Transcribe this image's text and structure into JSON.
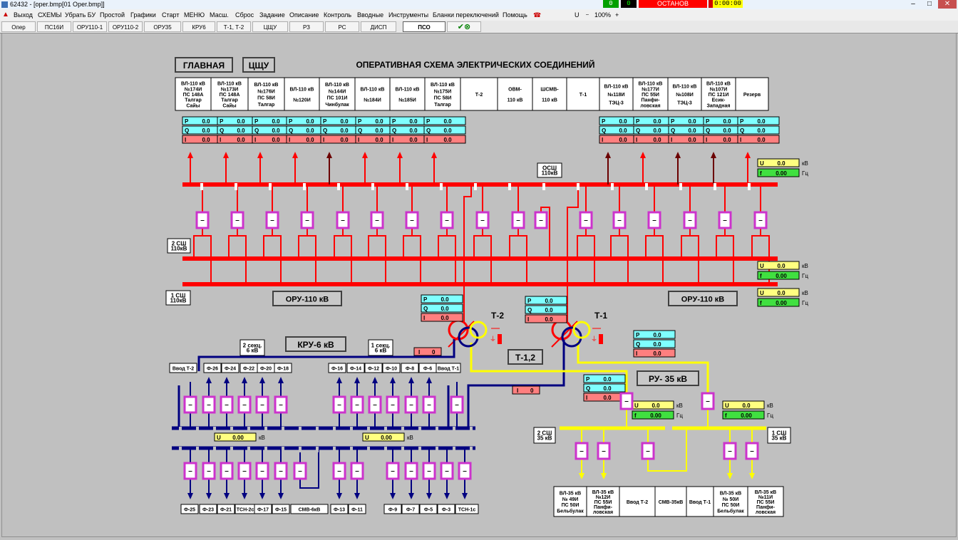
{
  "window": {
    "title": "62432 - [oper.bmp[01 Oper.bmp]]",
    "status_green": "0",
    "status_black": "0",
    "status_red": "ОСТАНОВ",
    "status_time": "0:00:00"
  },
  "menu": [
    "Выход",
    "СХЕМЫ",
    "Убрать БУ",
    "Простой",
    "Графики",
    "Старт",
    "МЕНЮ",
    "Масш.",
    "Сброс",
    "Задание",
    "Описание",
    "Контроль",
    "Вводные",
    "Инструменты",
    "Бланки переключений",
    "Помощь"
  ],
  "toolbar": {
    "u_label": "U",
    "zoom": "100%"
  },
  "tabs": [
    "Опер",
    "ПС16И",
    "ОРУ110-1",
    "ОРУ110-2",
    "ОРУ35",
    "КРУ6",
    "Т-1, Т-2",
    "ЦЩУ",
    "РЗ",
    "РС",
    "ДИСП",
    "ПСО"
  ],
  "header": {
    "title": "ОПЕРАТИВНАЯ СХЕМА ЭЛЕКТРИЧЕСКИХ СОЕДИНЕНИЙ",
    "main_button": "ГЛАВНАЯ",
    "cshu_button": "ЦЩУ"
  },
  "feeders": [
    {
      "l1": "ВЛ-110 кВ",
      "l2": "№174И",
      "l3": "ПС 148А",
      "l4": "Талгар",
      "l5": "Сайы"
    },
    {
      "l1": "ВЛ-110 кВ",
      "l2": "№173И",
      "l3": "ПС 148А",
      "l4": "Талгар",
      "l5": "Сайы"
    },
    {
      "l1": "ВЛ-110 кВ",
      "l2": "№176И",
      "l3": "ПС 58И",
      "l4": "Талгар",
      "l5": ""
    },
    {
      "l1": "ВЛ-110 кВ",
      "l2": "№120И",
      "l3": "",
      "l4": "",
      "l5": ""
    },
    {
      "l1": "ВЛ-110 кВ",
      "l2": "№144И",
      "l3": "ПС 101И",
      "l4": "Чинбулак",
      "l5": ""
    },
    {
      "l1": "ВЛ-110 кВ",
      "l2": "№184И",
      "l3": "",
      "l4": "",
      "l5": ""
    },
    {
      "l1": "ВЛ-110 кВ",
      "l2": "№185И",
      "l3": "",
      "l4": "",
      "l5": ""
    },
    {
      "l1": "ВЛ-110 кВ",
      "l2": "№175И",
      "l3": "ПС 58И",
      "l4": "Талгар",
      "l5": ""
    },
    {
      "l1": "Т-2",
      "l2": "",
      "l3": "",
      "l4": "",
      "l5": ""
    },
    {
      "l1": "ОВМ-",
      "l2": "110 кВ",
      "l3": "",
      "l4": "",
      "l5": ""
    },
    {
      "l1": "ШСМВ-",
      "l2": "110 кВ",
      "l3": "",
      "l4": "",
      "l5": ""
    },
    {
      "l1": "Т-1",
      "l2": "",
      "l3": "",
      "l4": "",
      "l5": ""
    },
    {
      "l1": "ВЛ-110 кВ",
      "l2": "№118И",
      "l3": "ТЭЦ-3",
      "l4": "",
      "l5": ""
    },
    {
      "l1": "ВЛ-110 кВ",
      "l2": "№177И",
      "l3": "ПС 55И",
      "l4": "Панфи-",
      "l5": "ловская"
    },
    {
      "l1": "ВЛ-110 кВ",
      "l2": "№108И",
      "l3": "ТЭЦ-3",
      "l4": "",
      "l5": ""
    },
    {
      "l1": "ВЛ-110 кВ",
      "l2": "№107И",
      "l3": "ПС 121И",
      "l4": "Есик-",
      "l5": "Западная"
    },
    {
      "l1": "Резерв",
      "l2": "",
      "l3": "",
      "l4": "",
      "l5": ""
    }
  ],
  "meas": {
    "p": "P",
    "q": "Q",
    "i": "I",
    "zero": "0.0",
    "zero_i": "0",
    "u": "U",
    "f": "f",
    "f_val": "0.00",
    "u6": "0.00"
  },
  "units": {
    "kv": "кВ",
    "hz": "Гц"
  },
  "bus110": {
    "osh": "ОСШ",
    "osh2": "110кВ",
    "sh2": "2 СШ",
    "sh2b": "110кВ",
    "sh1": "1 СШ",
    "sh1b": "110кВ",
    "oru_left": "ОРУ-110 кВ",
    "oru_right": "ОРУ-110 кВ"
  },
  "trans": {
    "t2": "Т-2",
    "t1": "Т-1",
    "t12": "Т-1,2"
  },
  "kru6": {
    "title": "КРУ-6 кВ",
    "sec2": "2 секц.",
    "sec2b": "6 кВ",
    "sec1": "1 секц.",
    "sec1b": "6 кВ",
    "top_left": [
      "Ввод Т-2",
      "Ф-26",
      "Ф-24",
      "Ф-22",
      "Ф-20",
      "Ф-18"
    ],
    "top_right": [
      "Ф-16",
      "Ф-14",
      "Ф-12",
      "Ф-10",
      "Ф-8",
      "Ф-6",
      "Ввод Т-1"
    ],
    "bot_left": [
      "Ф-25",
      "Ф-23",
      "Ф-21",
      "ТСН-2с",
      "Ф-17",
      "Ф-15",
      "СМВ-6кВ",
      "Ф-13",
      "Ф-11"
    ],
    "bot_right": [
      "Ф-9",
      "Ф-7",
      "Ф-5",
      "Ф-3",
      "ТСН-1с"
    ]
  },
  "ru35": {
    "title": "РУ- 35 кВ",
    "sh2": "2 СШ",
    "sh2b": "35 кВ",
    "sh1": "1 СШ",
    "sh1b": "35 кВ",
    "feeders": [
      {
        "l1": "ВЛ-35 кВ",
        "l2": "№ 49И",
        "l3": "ПС 50И",
        "l4": "Бельбулак",
        "l5": ""
      },
      {
        "l1": "ВЛ-35 кВ",
        "l2": "№12И",
        "l3": "ПС 55И",
        "l4": "Панфи-",
        "l5": "ловская"
      },
      {
        "l1": "Ввод Т-2",
        "l2": "",
        "l3": "",
        "l4": "",
        "l5": ""
      },
      {
        "l1": "СМВ-35кВ",
        "l2": "",
        "l3": "",
        "l4": "",
        "l5": ""
      },
      {
        "l1": "Ввод Т-1",
        "l2": "",
        "l3": "",
        "l4": "",
        "l5": ""
      },
      {
        "l1": "ВЛ-35 кВ",
        "l2": "№ 50И",
        "l3": "ПС 50И",
        "l4": "Бельбулак",
        "l5": ""
      },
      {
        "l1": "ВЛ-35 кВ",
        "l2": "№11И",
        "l3": "ПС 55И",
        "l4": "Панфи-",
        "l5": "ловская"
      }
    ]
  },
  "colors": {
    "hv": "#ff0000",
    "lv": "#000080",
    "mv": "#ffff00",
    "breaker": "#cc33cc",
    "meas_pq": "#7fffff",
    "meas_i": "#ff7f7f",
    "meas_u": "#ffff80",
    "meas_f": "#40e040",
    "dark": "#6b0000"
  }
}
